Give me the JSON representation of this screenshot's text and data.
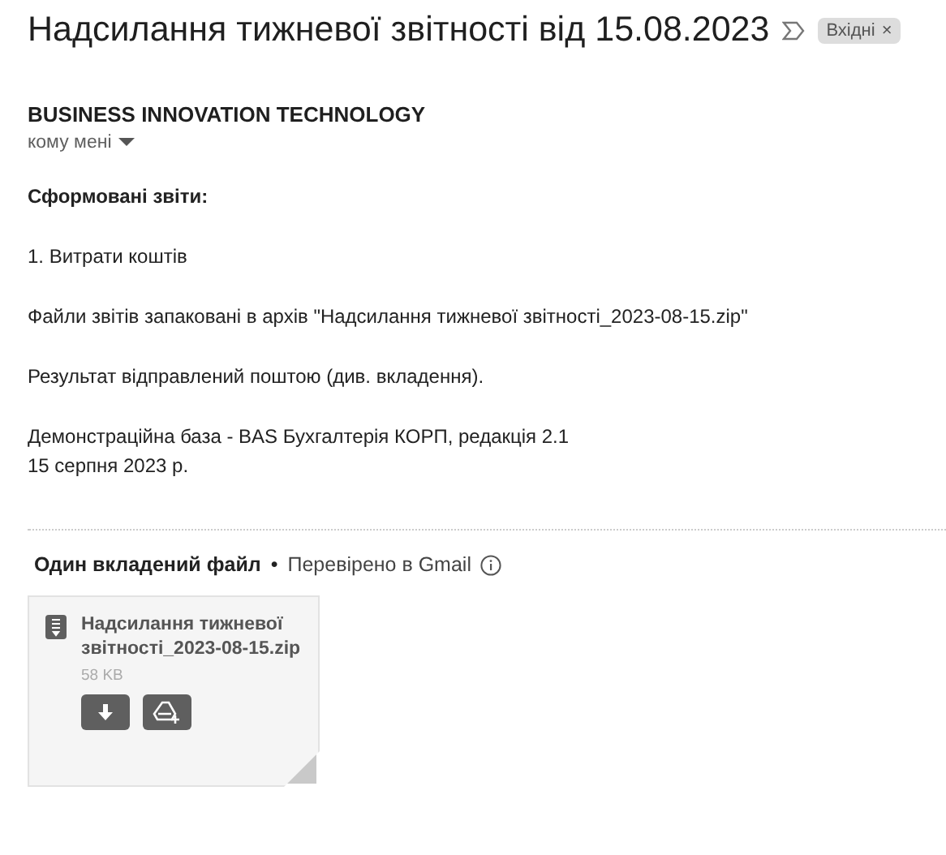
{
  "subject": "Надсилання тижневої звітності від 15.08.2023",
  "label": {
    "text": "Вхідні",
    "close": "×"
  },
  "sender": {
    "name": "BUSINESS INNOVATION TECHNOLOGY",
    "recipient": "кому мені"
  },
  "body": [
    {
      "kind": "heading",
      "lines": [
        "Сформовані звіти:"
      ]
    },
    {
      "kind": "text",
      "lines": [
        "1. Витрати коштів"
      ]
    },
    {
      "kind": "text",
      "lines": [
        "Файли звітів запаковані в архів \"Надсилання тижневої звітності_2023-08-15.zip\""
      ]
    },
    {
      "kind": "text",
      "lines": [
        "Результат відправлений поштою (див. вкладення)."
      ]
    },
    {
      "kind": "text",
      "lines": [
        "Демонстраційна база - BAS Бухгалтерія КОРП, редакція 2.1",
        "15 серпня 2023 р."
      ]
    }
  ],
  "attachments": {
    "title": "Один вкладений файл",
    "separator": "•",
    "scan": "Перевірено в Gmail",
    "files": [
      {
        "name": "Надсилання тижневої звітності_2023-08-15.zip",
        "size": "58 KB"
      }
    ]
  }
}
